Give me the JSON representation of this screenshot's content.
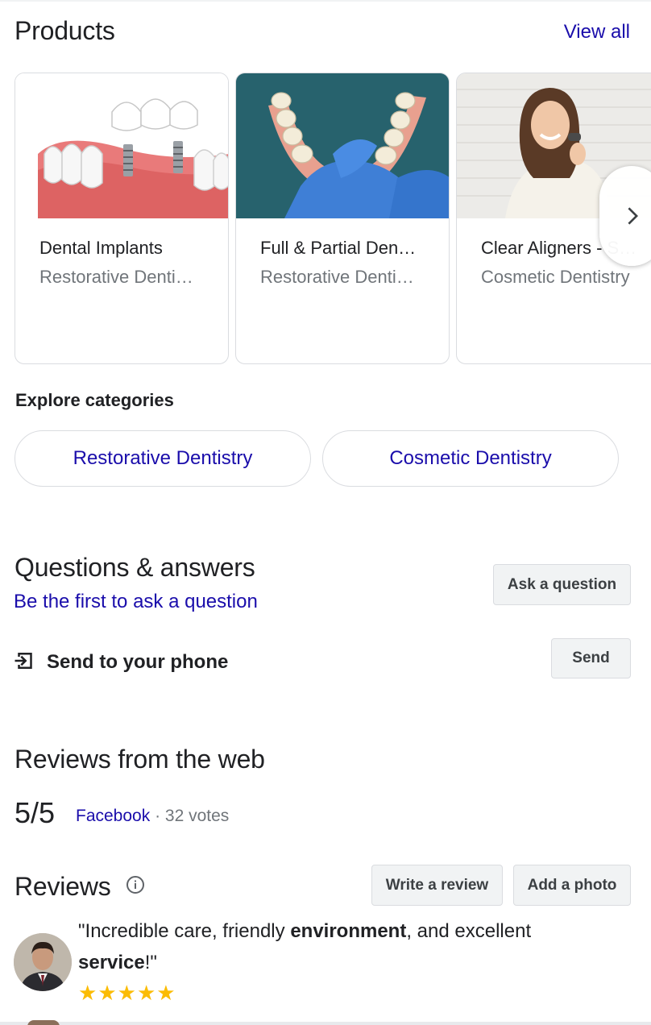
{
  "products": {
    "title": "Products",
    "view_all": "View all",
    "items": [
      {
        "name": "Dental Implants",
        "category": "Restorative Denti…"
      },
      {
        "name": "Full & Partial Den…",
        "category": "Restorative Denti…"
      },
      {
        "name": "Clear Aligners - S…",
        "category": "Cosmetic Dentistry"
      }
    ]
  },
  "explore": {
    "title": "Explore categories",
    "chips": [
      "Restorative Dentistry",
      "Cosmetic Dentistry"
    ]
  },
  "qa": {
    "title": "Questions & answers",
    "link": "Be the first to ask a question",
    "ask_button": "Ask a question"
  },
  "send": {
    "label": "Send to your phone",
    "button": "Send"
  },
  "web_reviews": {
    "title": "Reviews from the web",
    "score": "5/5",
    "source": "Facebook",
    "separator": " · ",
    "votes": "32 votes"
  },
  "reviews": {
    "title": "Reviews",
    "write_button": "Write a review",
    "photo_button": "Add a photo",
    "quote": {
      "part1": "\"Incredible care, friendly ",
      "bold1": "environment",
      "part2": ", and excellent ",
      "bold2": "service",
      "part3": "!\""
    },
    "rating": 5,
    "star": "★"
  },
  "colors": {
    "link": "#1a0dab",
    "star": "#fbbc04",
    "text": "#202124",
    "muted": "#70757a"
  }
}
